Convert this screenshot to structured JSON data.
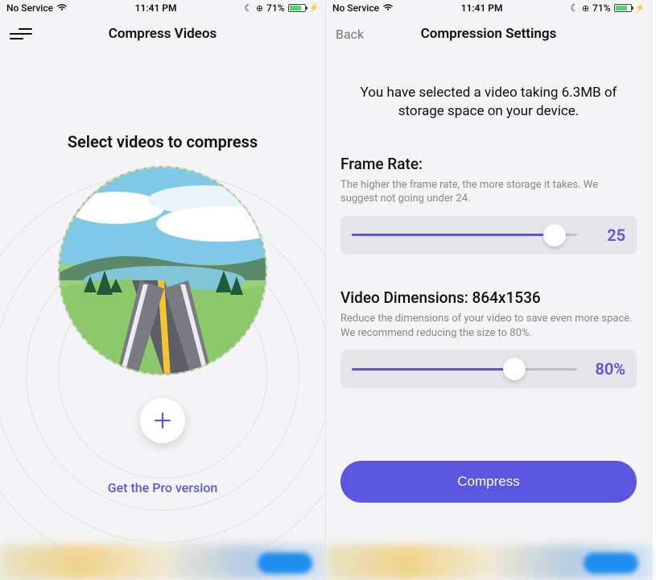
{
  "accent_color": "#5a56e0",
  "left": {
    "status": {
      "carrier": "No Service",
      "time": "11:41 PM",
      "battery_pct": "71%"
    },
    "nav_title": "Compress Videos",
    "prompt": "Select videos to compress",
    "pro_link": "Get the Pro version"
  },
  "right": {
    "status": {
      "carrier": "No Service",
      "time": "11:41 PM",
      "battery_pct": "71%"
    },
    "back_label": "Back",
    "nav_title": "Compression Settings",
    "selected_msg": "You have selected a video taking 6.3MB of storage space on your device.",
    "frame_rate": {
      "title": "Frame Rate:",
      "desc": "The higher the frame rate, the more storage it takes. We suggest not going under 24.",
      "value": "25",
      "fill_pct": "90%"
    },
    "dimensions": {
      "title": "Video Dimensions: 864x1536",
      "desc": "Reduce the dimensions of your video to save even more space. We recommend reducing the size to 80%.",
      "value": "80%",
      "fill_pct": "72%"
    },
    "compress_btn": "Compress"
  }
}
